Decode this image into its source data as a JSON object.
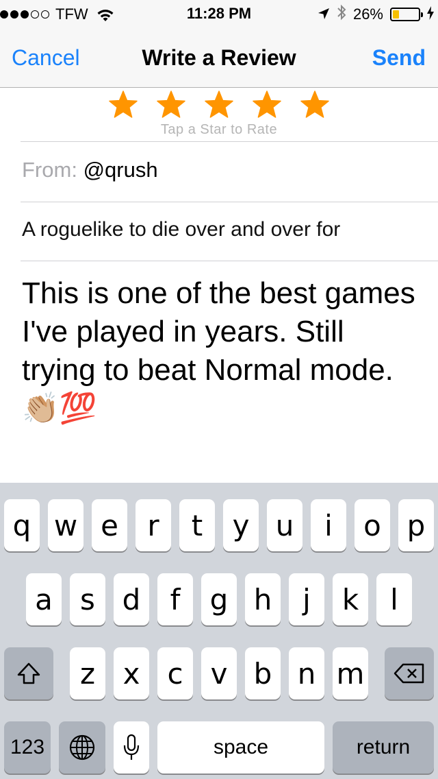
{
  "status_bar": {
    "carrier": "TFW",
    "time": "11:28 PM",
    "battery_percent": "26%",
    "battery_level": 0.26,
    "battery_color": "#f5c000",
    "signal_bars_filled": 3,
    "signal_bars_total": 5
  },
  "nav": {
    "cancel_label": "Cancel",
    "title": "Write a Review",
    "send_label": "Send"
  },
  "rating": {
    "stars_selected": 5,
    "stars_total": 5,
    "star_color": "#ff9500",
    "hint": "Tap a Star to Rate"
  },
  "from": {
    "label": "From:",
    "value": "@qrush"
  },
  "review": {
    "title": "A roguelike to die over and over for",
    "body": "This is one of the best games I've played in years. Still trying to beat Normal mode. 👏🏼💯"
  },
  "keyboard": {
    "row1": [
      "q",
      "w",
      "e",
      "r",
      "t",
      "y",
      "u",
      "i",
      "o",
      "p"
    ],
    "row2": [
      "a",
      "s",
      "d",
      "f",
      "g",
      "h",
      "j",
      "k",
      "l"
    ],
    "row3": [
      "z",
      "x",
      "c",
      "v",
      "b",
      "n",
      "m"
    ],
    "numbers_label": "123",
    "space_label": "space",
    "return_label": "return"
  },
  "colors": {
    "accent": "#1a82fb",
    "keyboard_bg": "#d1d5db",
    "special_key": "#adb3bc"
  },
  "icons": {
    "shift": "shift-icon",
    "backspace": "backspace-icon",
    "globe": "globe-icon",
    "mic": "microphone-icon",
    "wifi": "wifi-icon",
    "location": "location-arrow-icon",
    "bluetooth": "bluetooth-icon",
    "charging": "charging-bolt-icon"
  }
}
